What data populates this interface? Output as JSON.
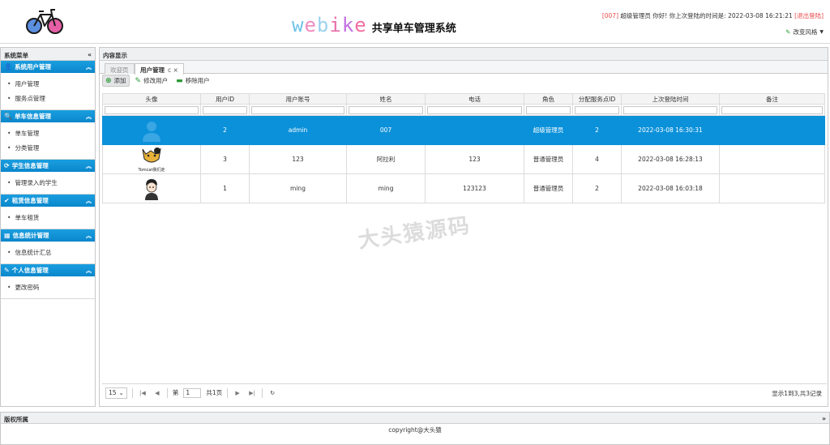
{
  "header": {
    "brand_en": [
      "w",
      "e",
      "b",
      "i",
      "k",
      "e"
    ],
    "brand_cn": "共享单车管理系统",
    "user_id": "[007]",
    "user_greeting": "超级管理员 你好! 你上次登陆的时间是:",
    "last_login": "2022-03-08 16:21:21",
    "logout_label": "[退出登陆]",
    "theme_label": "改变风格"
  },
  "sidebar": {
    "title": "系统菜单",
    "collapse_icon": "«",
    "sections": [
      {
        "title": "系统用户管理",
        "icon": "user-icon",
        "items": [
          "用户管理",
          "服务点管理"
        ]
      },
      {
        "title": "单车信息管理",
        "icon": "search-icon",
        "items": [
          "单车管理",
          "分类管理"
        ]
      },
      {
        "title": "学生信息管理",
        "icon": "refresh-icon",
        "items": [
          "管理录入的学生"
        ]
      },
      {
        "title": "租赁信息管理",
        "icon": "check-icon",
        "items": [
          "单车租赁"
        ]
      },
      {
        "title": "信息统计管理",
        "icon": "chart-icon",
        "items": [
          "信息统计汇总"
        ]
      },
      {
        "title": "个人信息管理",
        "icon": "pencil-icon",
        "items": [
          "更改密码"
        ]
      }
    ]
  },
  "main": {
    "title": "内容显示",
    "tabs": [
      {
        "label": "欢迎页",
        "active": false
      },
      {
        "label": "用户管理",
        "active": true,
        "close": "c ×"
      }
    ],
    "toolbar": {
      "add": "添加",
      "edit": "修改用户",
      "remove": "移除用户"
    },
    "columns": [
      "头像",
      "用户ID",
      "用户账号",
      "姓名",
      "电话",
      "角色",
      "分配服务点ID",
      "上次登陆时间",
      "备注"
    ],
    "rows": [
      {
        "avatar": "default-avatar",
        "id": "2",
        "account": "admin",
        "name": "007",
        "phone": "",
        "role": "超级管理员",
        "station": "2",
        "last_login": "2022-03-08 16:30:31",
        "note": "",
        "selected": true
      },
      {
        "avatar": "tomcat-avatar",
        "avatar_caption": "Tomcat我们走",
        "id": "3",
        "account": "123",
        "name": "阿拉利",
        "phone": "123",
        "role": "普通管理员",
        "station": "4",
        "last_login": "2022-03-08 16:28:13",
        "note": "",
        "selected": false
      },
      {
        "avatar": "cartoon-avatar",
        "id": "1",
        "account": "ming",
        "name": "ming",
        "phone": "123123",
        "role": "普通管理员",
        "station": "2",
        "last_login": "2022-03-08 16:03:18",
        "note": "",
        "selected": false
      }
    ],
    "watermark": "大头猿源码",
    "pager": {
      "page_size": "15",
      "page_prefix": "第",
      "page": "1",
      "total_pages": "共1页",
      "info": "显示1到3,共3记录"
    }
  },
  "footer": {
    "title": "版权所属",
    "text": "copyright@大头猿"
  }
}
